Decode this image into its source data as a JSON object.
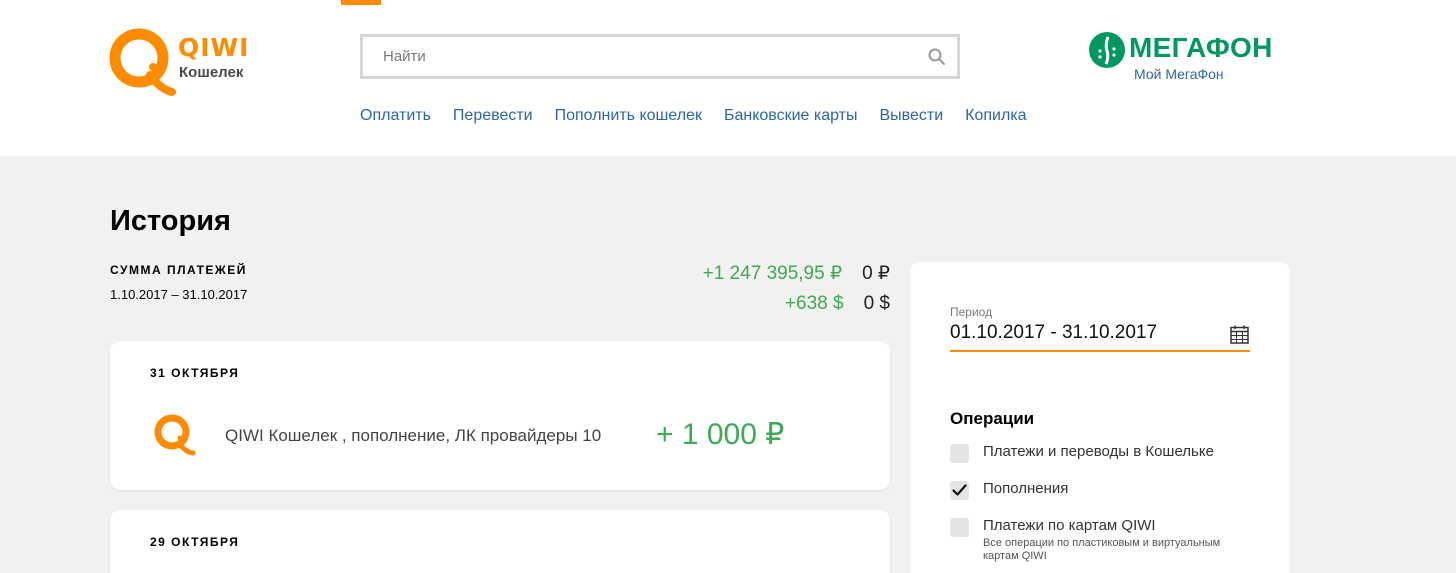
{
  "header": {
    "logo": {
      "brand": "QIWI",
      "subtitle": "Кошелек"
    },
    "search": {
      "placeholder": "Найти",
      "icon": "search-icon"
    },
    "nav": [
      {
        "label": "Оплатить"
      },
      {
        "label": "Перевести"
      },
      {
        "label": "Пополнить кошелек"
      },
      {
        "label": "Банковские карты"
      },
      {
        "label": "Вывести"
      },
      {
        "label": "Копилка"
      }
    ],
    "operator": {
      "name": "МЕГАФОН",
      "link": "Мой МегаФон"
    }
  },
  "history": {
    "title": "История",
    "summary": {
      "label": "СУММА ПЛАТЕЖЕЙ",
      "period": "1.10.2017 – 31.10.2017",
      "rows": [
        {
          "income": "+1 247 395,95 ₽",
          "expense": "0 ₽"
        },
        {
          "income": "+638 $",
          "expense": "0 $"
        }
      ]
    },
    "days": [
      {
        "date": "31 ОКТЯБРЯ",
        "transactions": [
          {
            "description": "QIWI Кошелек , пополнение, ЛК провайдеры 10",
            "amount": "+ 1 000 ₽"
          }
        ]
      },
      {
        "date": "29 ОКТЯБРЯ",
        "transactions": []
      }
    ]
  },
  "filters": {
    "period_label": "Период",
    "period_value": "01.10.2017 - 31.10.2017",
    "operations_title": "Операции",
    "operations": [
      {
        "label": "Платежи и переводы в Кошельке",
        "checked": false
      },
      {
        "label": "Пополнения",
        "checked": true
      },
      {
        "label": "Платежи по картам QIWI",
        "checked": false,
        "note": "Все операции по пластиковым и виртуальным картам QIWI"
      }
    ]
  },
  "colors": {
    "accent": "#ff8c00",
    "link": "#2d66a5",
    "positive": "#3fa954",
    "megafon": "#00985f",
    "background": "#f2f1ef"
  }
}
